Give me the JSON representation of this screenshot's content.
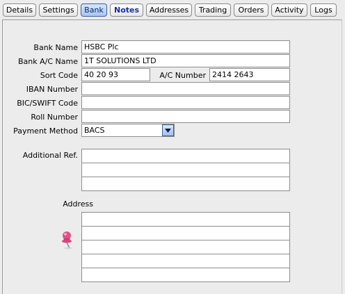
{
  "tabs": [
    {
      "label": "Details",
      "id": "details"
    },
    {
      "label": "Settings",
      "id": "settings"
    },
    {
      "label": "Bank",
      "id": "bank"
    },
    {
      "label": "Notes",
      "id": "notes"
    },
    {
      "label": "Addresses",
      "id": "addresses"
    },
    {
      "label": "Trading",
      "id": "trading"
    },
    {
      "label": "Orders",
      "id": "orders"
    },
    {
      "label": "Activity",
      "id": "activity"
    },
    {
      "label": "Logs",
      "id": "logs"
    }
  ],
  "active_tab": "Bank",
  "form": {
    "bank_name": {
      "label": "Bank Name",
      "value": "HSBC Plc"
    },
    "account_name": {
      "label": "Bank A/C Name",
      "value": "1T SOLUTIONS LTD"
    },
    "sort_code": {
      "label": "Sort Code",
      "value": "40 20 93"
    },
    "account_number": {
      "label": "A/C Number",
      "value": "2414 2643"
    },
    "iban": {
      "label": "IBAN Number",
      "value": ""
    },
    "bic": {
      "label": "BIC/SWIFT Code",
      "value": ""
    },
    "roll_number": {
      "label": "Roll Number",
      "value": ""
    },
    "payment_method": {
      "label": "Payment Method",
      "value": "BACS"
    },
    "additional_ref": {
      "label": "Additional Ref.",
      "lines": [
        "",
        "",
        ""
      ]
    },
    "address": {
      "label": "Address",
      "lines": [
        "",
        "",
        "",
        "",
        ""
      ]
    }
  },
  "icons": {
    "dropdown": "chevron-down-icon",
    "pin": "push-pin-icon"
  },
  "colors": {
    "active_tab": "#a9c6ef",
    "notes_tab_text": "#1b2fa0"
  }
}
